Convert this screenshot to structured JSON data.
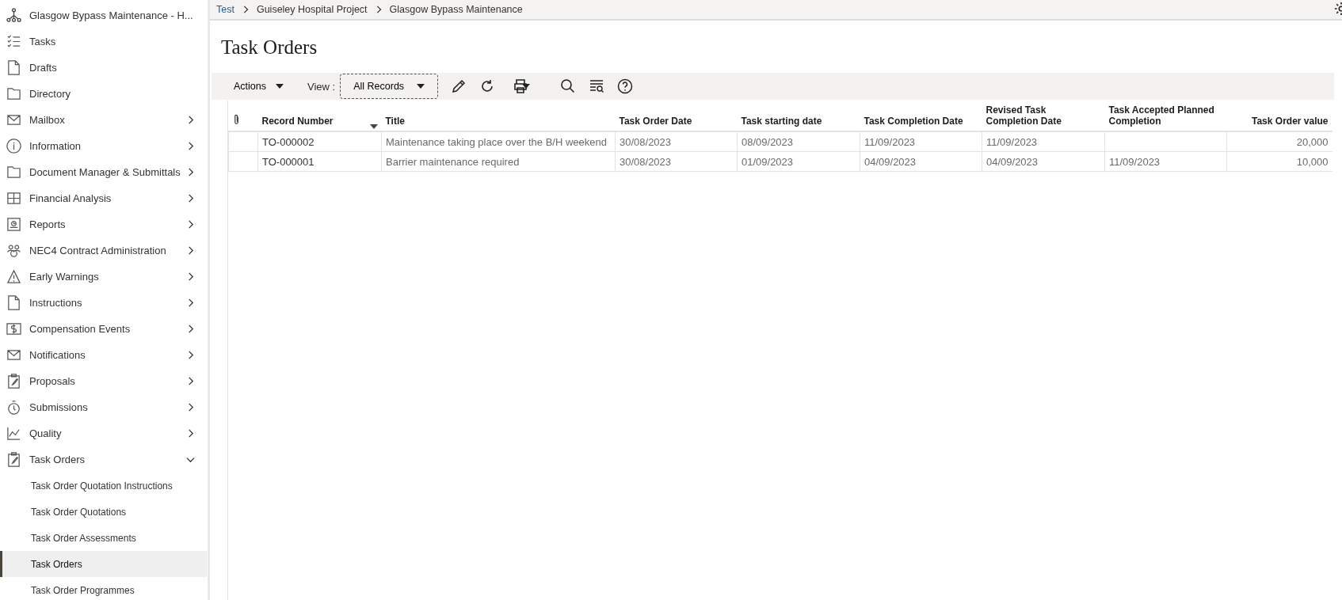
{
  "sidebar": {
    "project": "Glasgow Bypass Maintenance - H...",
    "items": [
      {
        "label": "Tasks",
        "expandable": false
      },
      {
        "label": "Drafts",
        "expandable": false
      },
      {
        "label": "Directory",
        "expandable": false
      },
      {
        "label": "Mailbox",
        "expandable": true,
        "expanded": false
      },
      {
        "label": "Information",
        "expandable": true,
        "expanded": false
      },
      {
        "label": "Document Manager & Submittals",
        "expandable": true,
        "expanded": false
      },
      {
        "label": "Financial Analysis",
        "expandable": true,
        "expanded": false
      },
      {
        "label": "Reports",
        "expandable": true,
        "expanded": false
      },
      {
        "label": "NEC4 Contract Administration",
        "expandable": true,
        "expanded": false
      },
      {
        "label": "Early Warnings",
        "expandable": true,
        "expanded": false
      },
      {
        "label": "Instructions",
        "expandable": true,
        "expanded": false
      },
      {
        "label": "Compensation Events",
        "expandable": true,
        "expanded": false
      },
      {
        "label": "Notifications",
        "expandable": true,
        "expanded": false
      },
      {
        "label": "Proposals",
        "expandable": true,
        "expanded": false
      },
      {
        "label": "Submissions",
        "expandable": true,
        "expanded": false
      },
      {
        "label": "Quality",
        "expandable": true,
        "expanded": false
      },
      {
        "label": "Task Orders",
        "expandable": true,
        "expanded": true,
        "children": [
          {
            "label": "Task Order Quotation Instructions",
            "selected": false
          },
          {
            "label": "Task Order Quotations",
            "selected": false
          },
          {
            "label": "Task Order Assessments",
            "selected": false
          },
          {
            "label": "Task Orders",
            "selected": true
          },
          {
            "label": "Task Order Programmes",
            "selected": false
          }
        ]
      }
    ]
  },
  "breadcrumb": [
    "Test",
    "Guiseley Hospital Project",
    "Glasgow Bypass Maintenance"
  ],
  "page_title": "Task Orders",
  "toolbar": {
    "actions": "Actions",
    "view_label": "View :",
    "view_value": "All Records"
  },
  "table": {
    "columns": [
      "Record Number",
      "Title",
      "Task Order Date",
      "Task starting date",
      "Task Completion Date",
      "Revised Task Completion Date",
      "Task Accepted Planned Completion",
      "Task Order value"
    ],
    "rows": [
      [
        "TO-000002",
        "Maintenance taking place over the B/H weekend",
        "30/08/2023",
        "08/09/2023",
        "11/09/2023",
        "11/09/2023",
        "",
        "20,000"
      ],
      [
        "TO-000001",
        "Barrier maintenance required",
        "30/08/2023",
        "01/09/2023",
        "04/09/2023",
        "04/09/2023",
        "11/09/2023",
        "10,000"
      ]
    ]
  }
}
